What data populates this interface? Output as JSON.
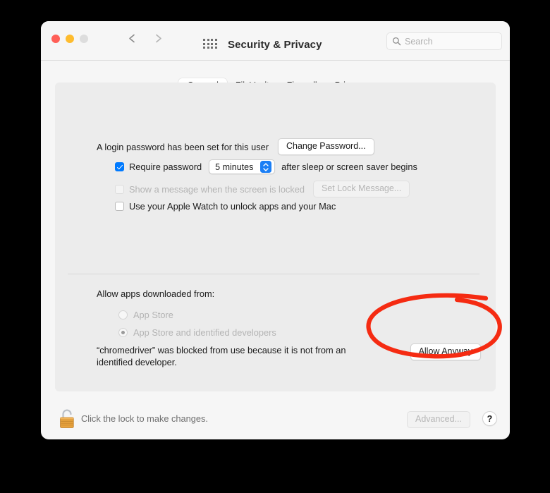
{
  "window": {
    "title": "Security & Privacy",
    "traffic_lights": [
      "close-red",
      "minimize-yellow",
      "zoom-gray"
    ],
    "back_icon": "chevron-left-icon",
    "forward_icon": "chevron-right-icon",
    "grid_icon": "show-all-grid-icon"
  },
  "search": {
    "placeholder": "Search",
    "value": "",
    "icon": "search-icon"
  },
  "tabs": [
    {
      "label": "General",
      "active": true
    },
    {
      "label": "FileVault",
      "active": false
    },
    {
      "label": "Firewall",
      "active": false
    },
    {
      "label": "Privacy",
      "active": false
    }
  ],
  "general": {
    "password_status": "A login password has been set for this user",
    "change_password_label": "Change Password...",
    "require_password": {
      "label": "Require password",
      "checked": true,
      "delay_value": "5 minutes",
      "suffix": "after sleep or screen saver begins"
    },
    "lock_message": {
      "label": "Show a message when the screen is locked",
      "checked": false,
      "disabled": true,
      "button_label": "Set Lock Message..."
    },
    "apple_watch": {
      "label": "Use your Apple Watch to unlock apps and your Mac",
      "checked": false,
      "disabled": false
    },
    "allow_apps_heading": "Allow apps downloaded from:",
    "allow_options": [
      {
        "label": "App Store",
        "selected": false,
        "disabled": true
      },
      {
        "label": "App Store and identified developers",
        "selected": true,
        "disabled": true
      }
    ],
    "blocked_message_line1": "“chromedriver” was blocked from use because it is not from an",
    "blocked_message_line2": "identified developer.",
    "allow_anyway_label": "Allow Anyway"
  },
  "footer": {
    "lock_icon": "open-padlock-icon",
    "lock_message": "Click the lock to make changes.",
    "advanced_label": "Advanced...",
    "advanced_disabled": true,
    "help_label": "?"
  },
  "annotation": {
    "shape": "hand-drawn-ellipse",
    "color": "#f52b12",
    "target": "Allow Anyway"
  },
  "colors": {
    "accent": "#007aff",
    "annotation": "#f52b12",
    "panel": "#ececec",
    "window": "#f6f6f6",
    "lock_gold": "#e8a33d"
  }
}
